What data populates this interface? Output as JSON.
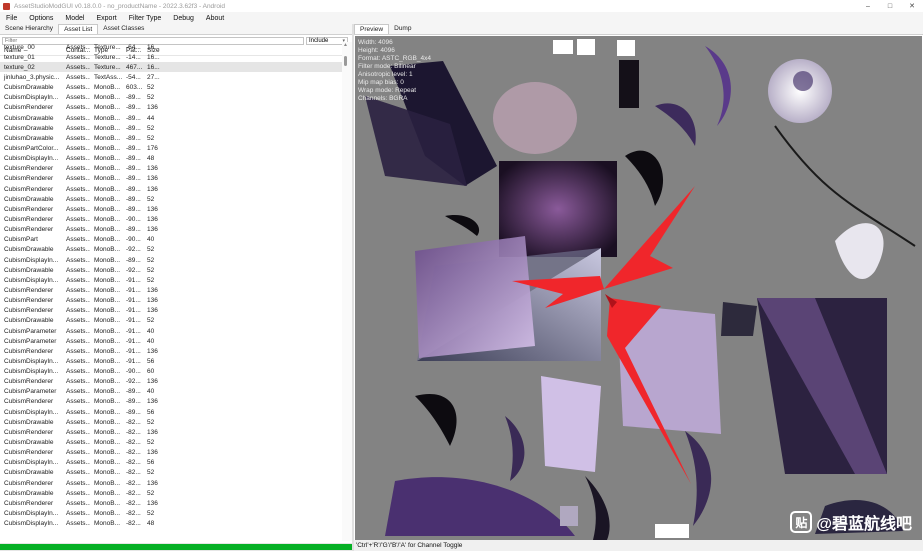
{
  "window": {
    "title": "AssetStudioModGUI v0.18.0.0 - no_productName - 2022.3.62f3 - Android",
    "controls": [
      "–",
      "□",
      "✕"
    ]
  },
  "menu": [
    "File",
    "Options",
    "Model",
    "Export",
    "Filter Type",
    "Debug",
    "About"
  ],
  "left_tabs": [
    "Scene Hierarchy",
    "Asset List",
    "Asset Classes"
  ],
  "left_active_tab": 1,
  "filter": {
    "placeholder": "Filter",
    "include_label": "Include"
  },
  "columns": [
    "Name",
    "Contai...",
    "Type",
    "Pat...",
    "Size"
  ],
  "rows": [
    [
      "texture_00",
      "Assets...",
      "Texture...",
      "-64...",
      "16..."
    ],
    [
      "texture_01",
      "Assets...",
      "Texture...",
      "-14...",
      "16..."
    ],
    [
      "texture_02",
      "Assets...",
      "Texture...",
      "467...",
      "16..."
    ],
    [
      "jinluhao_3.physic...",
      "Assets...",
      "TextAss...",
      "-54...",
      "27..."
    ],
    [
      "CubismDrawable",
      "Assets...",
      "MonoB...",
      "603...",
      "52"
    ],
    [
      "CubismDisplayIn...",
      "Assets...",
      "MonoB...",
      "-89...",
      "52"
    ],
    [
      "CubismRenderer",
      "Assets...",
      "MonoB...",
      "-89...",
      "136"
    ],
    [
      "CubismDrawable",
      "Assets...",
      "MonoB...",
      "-89...",
      "44"
    ],
    [
      "CubismDrawable",
      "Assets...",
      "MonoB...",
      "-89...",
      "52"
    ],
    [
      "CubismDrawable",
      "Assets...",
      "MonoB...",
      "-89...",
      "52"
    ],
    [
      "CubismPartColor...",
      "Assets...",
      "MonoB...",
      "-89...",
      "176"
    ],
    [
      "CubismDisplayIn...",
      "Assets...",
      "MonoB...",
      "-89...",
      "48"
    ],
    [
      "CubismRenderer",
      "Assets...",
      "MonoB...",
      "-89...",
      "136"
    ],
    [
      "CubismRenderer",
      "Assets...",
      "MonoB...",
      "-89...",
      "136"
    ],
    [
      "CubismRenderer",
      "Assets...",
      "MonoB...",
      "-89...",
      "136"
    ],
    [
      "CubismDrawable",
      "Assets...",
      "MonoB...",
      "-89...",
      "52"
    ],
    [
      "CubismRenderer",
      "Assets...",
      "MonoB...",
      "-89...",
      "136"
    ],
    [
      "CubismRenderer",
      "Assets...",
      "MonoB...",
      "-90...",
      "136"
    ],
    [
      "CubismRenderer",
      "Assets...",
      "MonoB...",
      "-89...",
      "136"
    ],
    [
      "CubismPart",
      "Assets...",
      "MonoB...",
      "-90...",
      "40"
    ],
    [
      "CubismDrawable",
      "Assets...",
      "MonoB...",
      "-92...",
      "52"
    ],
    [
      "CubismDisplayIn...",
      "Assets...",
      "MonoB...",
      "-89...",
      "52"
    ],
    [
      "CubismDrawable",
      "Assets...",
      "MonoB...",
      "-92...",
      "52"
    ],
    [
      "CubismDisplayIn...",
      "Assets...",
      "MonoB...",
      "-91...",
      "52"
    ],
    [
      "CubismRenderer",
      "Assets...",
      "MonoB...",
      "-91...",
      "136"
    ],
    [
      "CubismRenderer",
      "Assets...",
      "MonoB...",
      "-91...",
      "136"
    ],
    [
      "CubismRenderer",
      "Assets...",
      "MonoB...",
      "-91...",
      "136"
    ],
    [
      "CubismDrawable",
      "Assets...",
      "MonoB...",
      "-91...",
      "52"
    ],
    [
      "CubismParameter",
      "Assets...",
      "MonoB...",
      "-91...",
      "40"
    ],
    [
      "CubismParameter",
      "Assets...",
      "MonoB...",
      "-91...",
      "40"
    ],
    [
      "CubismRenderer",
      "Assets...",
      "MonoB...",
      "-91...",
      "136"
    ],
    [
      "CubismDisplayIn...",
      "Assets...",
      "MonoB...",
      "-91...",
      "56"
    ],
    [
      "CubismDisplayIn...",
      "Assets...",
      "MonoB...",
      "-90...",
      "60"
    ],
    [
      "CubismRenderer",
      "Assets...",
      "MonoB...",
      "-92...",
      "136"
    ],
    [
      "CubismParameter",
      "Assets...",
      "MonoB...",
      "-89...",
      "40"
    ],
    [
      "CubismRenderer",
      "Assets...",
      "MonoB...",
      "-89...",
      "136"
    ],
    [
      "CubismDisplayIn...",
      "Assets...",
      "MonoB...",
      "-89...",
      "56"
    ],
    [
      "CubismDrawable",
      "Assets...",
      "MonoB...",
      "-82...",
      "52"
    ],
    [
      "CubismRenderer",
      "Assets...",
      "MonoB...",
      "-82...",
      "136"
    ],
    [
      "CubismDrawable",
      "Assets...",
      "MonoB...",
      "-82...",
      "52"
    ],
    [
      "CubismRenderer",
      "Assets...",
      "MonoB...",
      "-82...",
      "136"
    ],
    [
      "CubismDisplayIn...",
      "Assets...",
      "MonoB...",
      "-82...",
      "56"
    ],
    [
      "CubismDrawable",
      "Assets...",
      "MonoB...",
      "-82...",
      "52"
    ],
    [
      "CubismRenderer",
      "Assets...",
      "MonoB...",
      "-82...",
      "136"
    ],
    [
      "CubismDrawable",
      "Assets...",
      "MonoB...",
      "-82...",
      "52"
    ],
    [
      "CubismRenderer",
      "Assets...",
      "MonoB...",
      "-82...",
      "136"
    ],
    [
      "CubismDisplayIn...",
      "Assets...",
      "MonoB...",
      "-82...",
      "52"
    ],
    [
      "CubismDisplayIn...",
      "Assets...",
      "MonoB...",
      "-82...",
      "48"
    ]
  ],
  "selected_row": 2,
  "right_tabs": [
    "Preview",
    "Dump"
  ],
  "right_active_tab": 0,
  "texture_info": [
    "Width: 4096",
    "Height: 4096",
    "Format: ASTC_RGB_4x4",
    "Filter mode: Bilinear",
    "Anisotropic level: 1",
    "Mip map bias: 0",
    "Wrap mode: Repeat",
    "Channels: BGRA"
  ],
  "status": "'Ctrl'+'R'/'G'/'B'/'A' for Channel Toggle",
  "progress": 1.0,
  "watermark": {
    "logo": "贴",
    "text": "@碧蓝航线吧"
  },
  "colors": {
    "progress": "#06b025",
    "preview_bg": "#838383",
    "arrow": "#f0262b"
  }
}
